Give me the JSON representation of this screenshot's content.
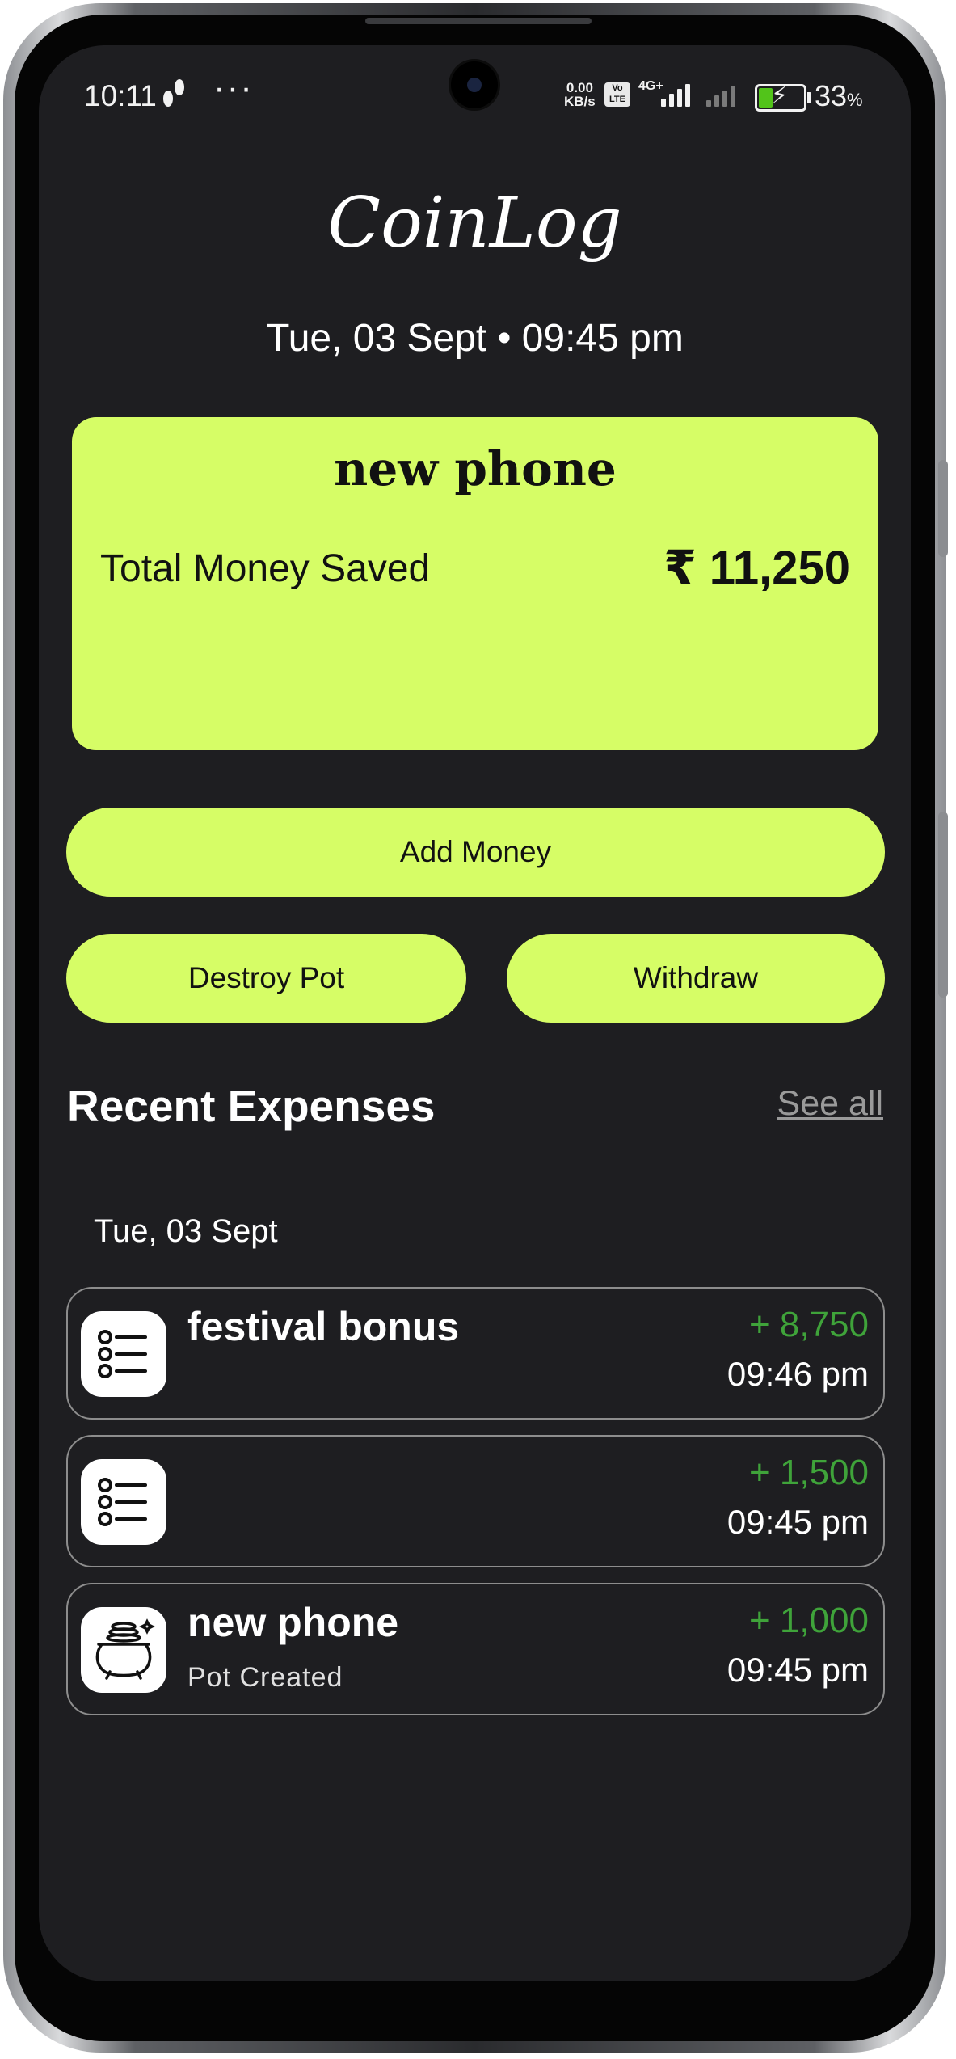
{
  "status_bar": {
    "time": "10:11",
    "dots": "···",
    "net_speed_value": "0.00",
    "net_speed_unit": "KB/s",
    "volte": "Vo LTE",
    "network_type": "4G+",
    "battery_percent": "33",
    "battery_unit": "%",
    "battery_level": 0.33,
    "charging": true
  },
  "app": {
    "title": "CoinLog",
    "datetime": "Tue, 03 Sept • 09:45 pm"
  },
  "pot_card": {
    "name": "new phone",
    "label": "Total Money Saved",
    "amount": "₹ 11,250",
    "background_color": "#d6fd66"
  },
  "actions": {
    "add_money": "Add Money",
    "destroy_pot": "Destroy Pot",
    "withdraw": "Withdraw"
  },
  "recent": {
    "title": "Recent Expenses",
    "see_all": "See all",
    "groups": [
      {
        "date": "Tue, 03 Sept",
        "items": [
          {
            "title": "festival bonus",
            "subtitle": "",
            "amount": "+ 8,750",
            "time": "09:46 pm",
            "icon": "list-icon"
          },
          {
            "title": "",
            "subtitle": "",
            "amount": "+ 1,500",
            "time": "09:45 pm",
            "icon": "list-icon"
          },
          {
            "title": "new phone",
            "subtitle": "Pot Created",
            "amount": "+ 1,000",
            "time": "09:45 pm",
            "icon": "pot-of-coins-icon"
          }
        ]
      }
    ]
  },
  "colors": {
    "accent": "#d6fd66",
    "background": "#1e1e21",
    "positive_amount": "#3fa33a"
  }
}
